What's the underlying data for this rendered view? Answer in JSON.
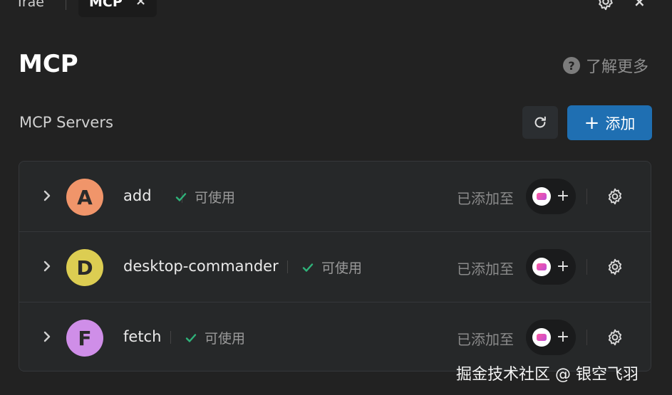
{
  "tabs": {
    "previous_label": "Trae",
    "active_label": "MCP",
    "close_icon": "×"
  },
  "header": {
    "title": "MCP",
    "learn_more": "了解更多",
    "help_icon": "?"
  },
  "section": {
    "title": "MCP Servers",
    "add_label": "添加",
    "add_icon": "+"
  },
  "servers": [
    {
      "initial": "A",
      "name": "add",
      "status": "可使用",
      "added_label": "已添加至",
      "avatar_color": "#f0956a"
    },
    {
      "initial": "D",
      "name": "desktop-commander",
      "status": "可使用",
      "added_label": "已添加至",
      "avatar_color": "#dccd52"
    },
    {
      "initial": "F",
      "name": "fetch",
      "status": "可使用",
      "added_label": "已添加至",
      "avatar_color": "#cf8ee8"
    }
  ],
  "chip_plus": "+",
  "watermark": "掘金技术社区 @ 银空飞羽",
  "colors": {
    "accent": "#1f6fb2",
    "status_ok": "#2fb37a"
  }
}
